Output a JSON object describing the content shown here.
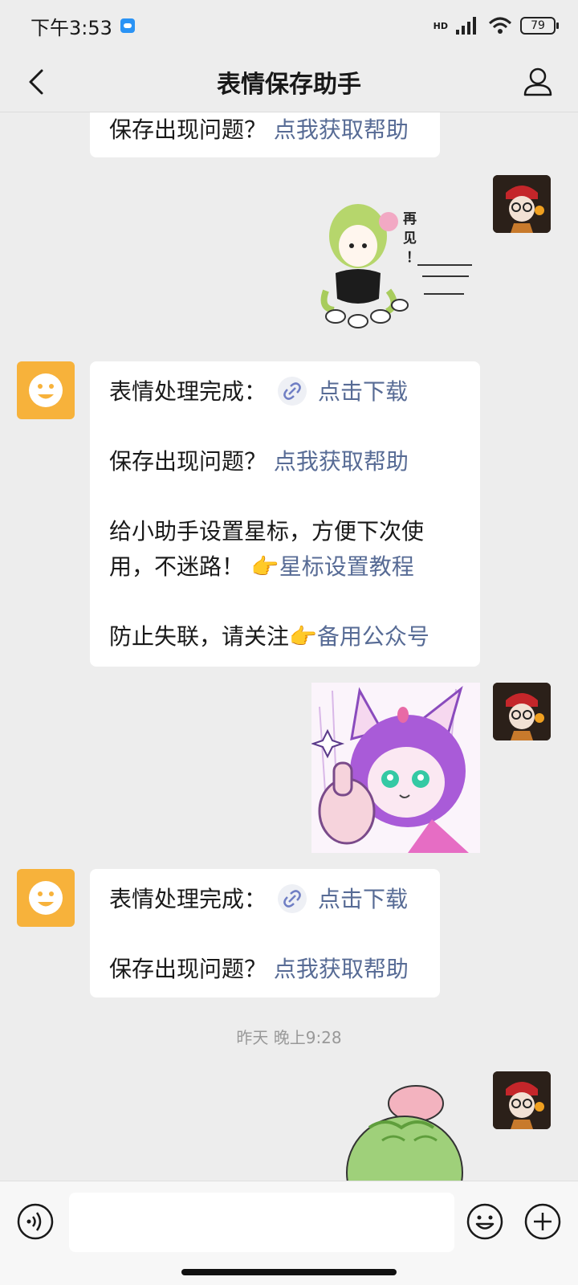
{
  "status_bar": {
    "time": "下午3:53",
    "network": "HD",
    "battery": "79"
  },
  "header": {
    "title": "表情保存助手"
  },
  "messages": [
    {
      "sender": "bot",
      "lines": [
        {
          "text": "保存出现问题？",
          "link": "点我获取帮助"
        }
      ]
    },
    {
      "sender": "me",
      "type": "sticker",
      "sticker_text": [
        "再",
        "见",
        "！"
      ]
    },
    {
      "sender": "bot",
      "lines": [
        {
          "text": "表情处理完成：",
          "link": "点击下载",
          "icon": "mini-program-link-icon"
        },
        {
          "text": "保存出现问题？",
          "link": "点我获取帮助"
        },
        {
          "text": "给小助手设置星标，方便下次使"
        },
        {
          "text": "用，不迷路！",
          "emoji": "👉",
          "link": "星标设置教程"
        },
        {
          "text": "防止失联，请关注",
          "emoji": "👉",
          "link": "备用公众号"
        }
      ]
    },
    {
      "sender": "me",
      "type": "sticker"
    },
    {
      "sender": "bot",
      "lines": [
        {
          "text": "表情处理完成：",
          "link": "点击下载",
          "icon": "mini-program-link-icon"
        },
        {
          "text": "保存出现问题？",
          "link": "点我获取帮助"
        }
      ]
    },
    {
      "type": "timestamp",
      "text": "昨天 晚上9:28"
    },
    {
      "sender": "me",
      "type": "sticker"
    }
  ],
  "input_bar": {
    "voice_icon": "voice-icon",
    "emoji_icon": "emoji-icon",
    "plus_icon": "plus-icon",
    "input_value": ""
  },
  "colors": {
    "background": "#ededed",
    "link": "#576b95",
    "bot_avatar": "#f7b23b",
    "bubble": "#ffffff"
  }
}
